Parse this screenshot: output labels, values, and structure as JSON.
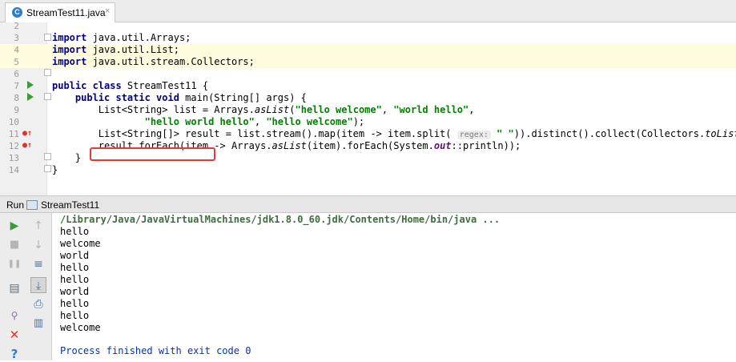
{
  "tab": {
    "filename": "StreamTest11.java",
    "icon": "java-class-icon",
    "close": "×"
  },
  "editor": {
    "lines": [
      {
        "num": "2"
      },
      {
        "num": "3",
        "tokens": [
          [
            "kw",
            "import"
          ],
          [
            "p",
            " java.util.Arrays;"
          ]
        ]
      },
      {
        "num": "4",
        "tokens": [
          [
            "kw",
            "import"
          ],
          [
            "p",
            " java.util.List;"
          ]
        ]
      },
      {
        "num": "5",
        "tokens": [
          [
            "kw",
            "import"
          ],
          [
            "p",
            " java.util.stream.Collectors;"
          ]
        ]
      },
      {
        "num": "6"
      },
      {
        "num": "7",
        "tokens": [
          [
            "kw",
            "public class"
          ],
          [
            "p",
            " StreamTest11 {"
          ]
        ]
      },
      {
        "num": "8",
        "tokens": [
          [
            "p",
            "    "
          ],
          [
            "kw",
            "public static void"
          ],
          [
            "p",
            " main(String[] args) {"
          ]
        ]
      },
      {
        "num": "9",
        "tokens": [
          [
            "p",
            "        List<String> list = Arrays."
          ],
          [
            "it",
            "asList"
          ],
          [
            "p",
            "("
          ],
          [
            "str",
            "\"hello welcome\""
          ],
          [
            "p",
            ", "
          ],
          [
            "str",
            "\"world hello\""
          ],
          [
            "p",
            ","
          ]
        ]
      },
      {
        "num": "10",
        "tokens": [
          [
            "p",
            "                "
          ],
          [
            "str",
            "\"hello world hello\""
          ],
          [
            "p",
            ", "
          ],
          [
            "str",
            "\"hello welcome\""
          ],
          [
            "p",
            ");"
          ]
        ]
      },
      {
        "num": "11",
        "tokens": [
          [
            "p",
            "        List<String[]> result = list.stream().map(item -> item.split( "
          ],
          [
            "hint",
            "regex:"
          ],
          [
            "p",
            " "
          ],
          [
            "str",
            "\" \""
          ],
          [
            "p",
            ")).distinct().collect(Collectors."
          ],
          [
            "it",
            "toList"
          ],
          [
            "p",
            "());"
          ]
        ]
      },
      {
        "num": "12",
        "tokens": [
          [
            "p",
            "        result.forEach(item -> Arrays."
          ],
          [
            "it",
            "asList"
          ],
          [
            "p",
            "(item).forEach(System."
          ],
          [
            "fld",
            "out"
          ],
          [
            "p",
            "::println));"
          ]
        ]
      },
      {
        "num": "13",
        "tokens": [
          [
            "p",
            "    }"
          ]
        ]
      },
      {
        "num": "14",
        "tokens": [
          [
            "p",
            "}"
          ]
        ]
      }
    ]
  },
  "run_panel": {
    "label": "Run",
    "config_name": "StreamTest11"
  },
  "console": {
    "command": "/Library/Java/JavaVirtualMachines/jdk1.8.0_60.jdk/Contents/Home/bin/java ...",
    "output": [
      "hello",
      "welcome",
      "world",
      "hello",
      "hello",
      "world",
      "hello",
      "hello",
      "welcome"
    ],
    "exit_message": "Process finished with exit code 0"
  },
  "toolbar_icons": {
    "run": "▶",
    "stop": "■",
    "pause": "❚❚",
    "up": "↑",
    "down": "↓",
    "soft_wrap": "≡",
    "scroll_end": "⤓",
    "print": "⎙",
    "trash": "🗑",
    "pin": "📌",
    "close": "✕",
    "help": "?"
  },
  "colors": {
    "keyword": "#000080",
    "string": "#008000",
    "highlight": "#fffbde",
    "run_green": "#3d9b35",
    "annotation_red": "#e53935"
  }
}
